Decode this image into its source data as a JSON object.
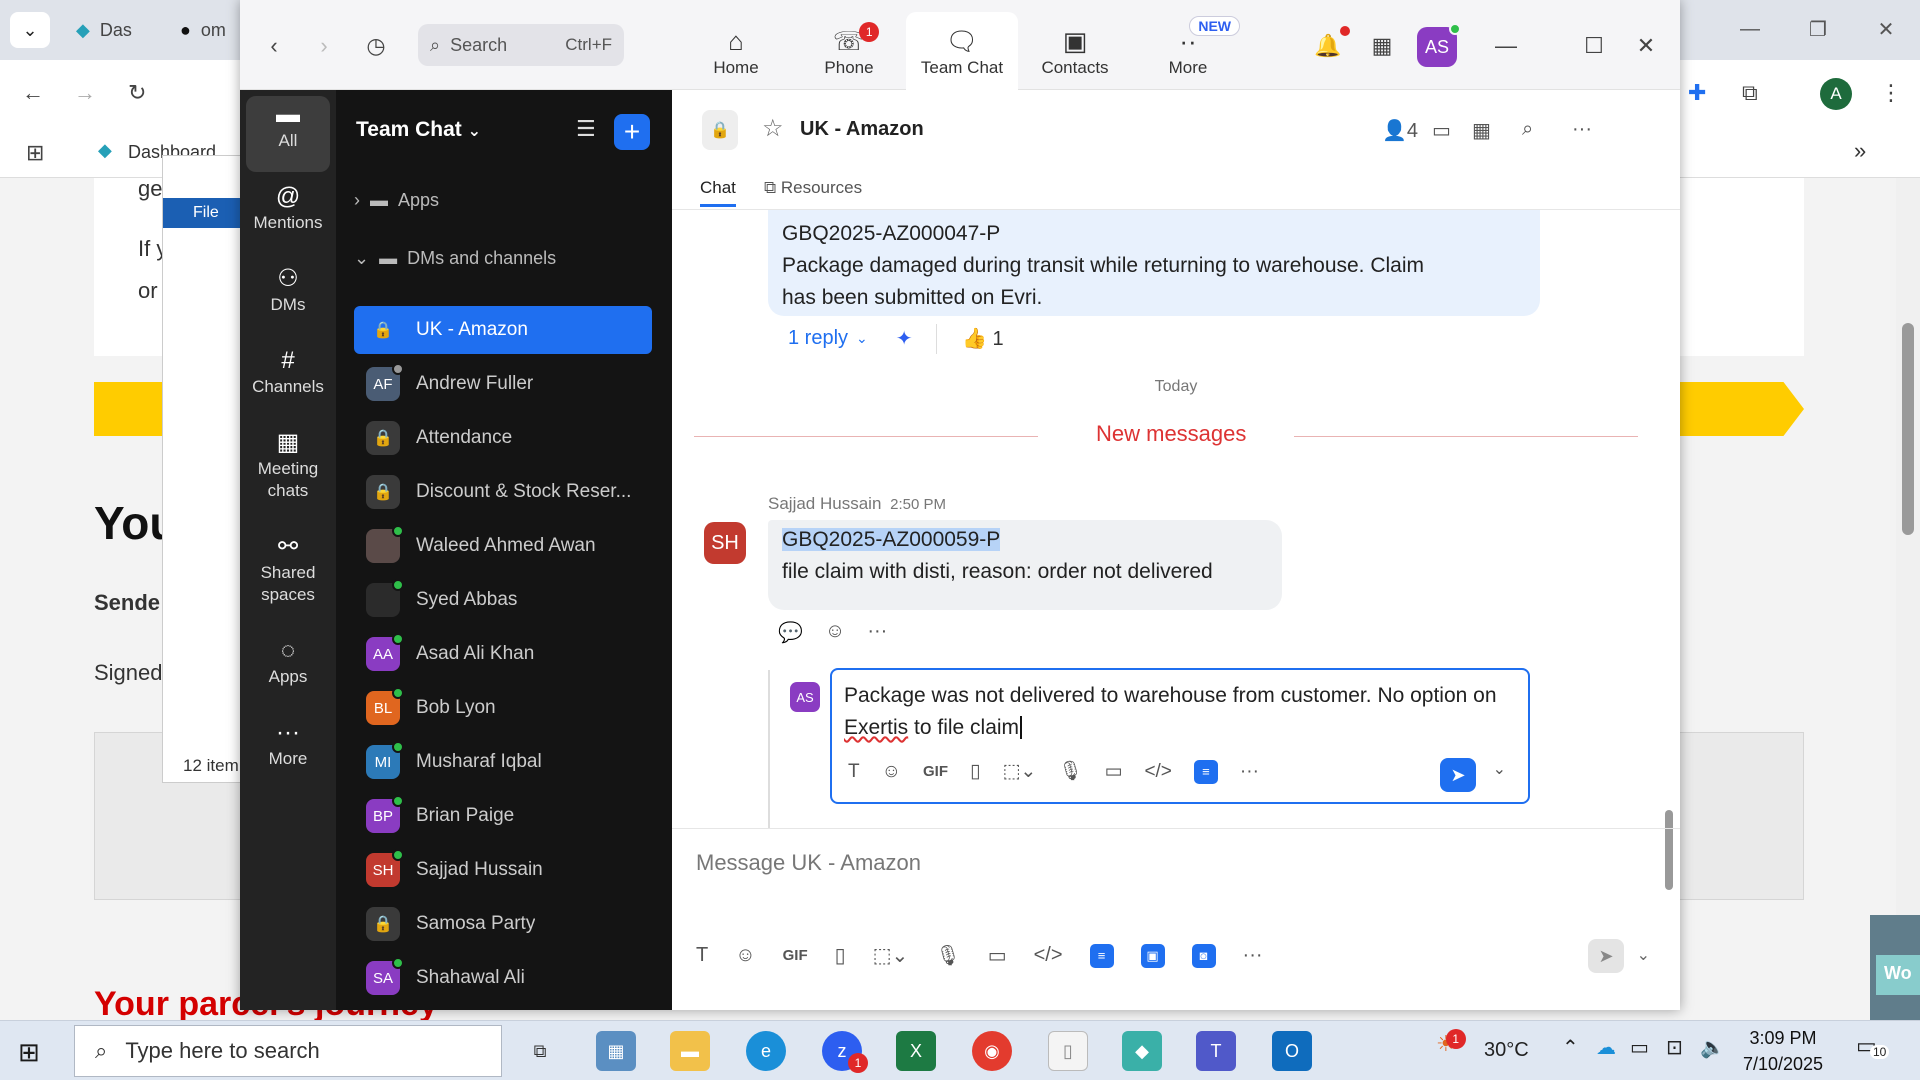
{
  "browser": {
    "tabs": [
      {
        "label": "Das"
      },
      {
        "label": "om"
      }
    ],
    "bookmark": "Dashboard",
    "page": {
      "snippet1": "ge",
      "snippet2": "If y",
      "snippet3": "or",
      "heading": "You",
      "sender_label": "Sende",
      "signed_label": "Signed",
      "journey_heading": "Your parcel's journey"
    },
    "explorer": {
      "file_tab": "File",
      "items_count": "12 item"
    },
    "corner_label": "Wo"
  },
  "zoom": {
    "search": {
      "placeholder": "Search",
      "shortcut": "Ctrl+F"
    },
    "tabs": [
      {
        "label": "Home",
        "icon": "home-icon"
      },
      {
        "label": "Phone",
        "icon": "phone-icon",
        "badge": "1"
      },
      {
        "label": "Team Chat",
        "icon": "chat-bubble-icon",
        "active": true
      },
      {
        "label": "Contacts",
        "icon": "contacts-icon"
      },
      {
        "label": "More",
        "icon": "more-icon",
        "badge": "NEW"
      }
    ],
    "user_initials": "AS",
    "rail": [
      {
        "label": "All",
        "icon": "chat-icon",
        "active": true
      },
      {
        "label": "Mentions",
        "icon": "at-icon"
      },
      {
        "label": "DMs",
        "icon": "people-icon"
      },
      {
        "label": "Channels",
        "icon": "hash-icon"
      },
      {
        "label": "Meeting chats",
        "icon": "calendar-icon"
      },
      {
        "label": "Shared spaces",
        "icon": "share-icon"
      },
      {
        "label": "Apps",
        "icon": "apps-icon"
      },
      {
        "label": "More",
        "icon": "ellipsis-icon"
      }
    ],
    "channel_list": {
      "title": "Team Chat",
      "sections": {
        "apps": "Apps",
        "dms": "DMs and channels"
      },
      "items": [
        {
          "name": "UK - Amazon",
          "type": "lock",
          "active": true
        },
        {
          "name": "Andrew Fuller",
          "type": "avatar",
          "initials": "AF",
          "color": "#4a5c74",
          "status": "away"
        },
        {
          "name": "Attendance",
          "type": "lock"
        },
        {
          "name": "Discount & Stock Reser...",
          "type": "lock"
        },
        {
          "name": "Waleed Ahmed Awan",
          "type": "photo",
          "color": "#5a4a48",
          "status": "online"
        },
        {
          "name": "Syed Abbas",
          "type": "photo",
          "color": "#2b2b2b",
          "status": "online"
        },
        {
          "name": "Asad Ali Khan",
          "type": "avatar",
          "initials": "AA",
          "color": "#8a3cc2",
          "status": "online"
        },
        {
          "name": "Bob Lyon",
          "type": "avatar",
          "initials": "BL",
          "color": "#e0661f",
          "status": "online"
        },
        {
          "name": "Musharaf Iqbal",
          "type": "avatar",
          "initials": "MI",
          "color": "#2c7ab8",
          "status": "online"
        },
        {
          "name": "Brian Paige",
          "type": "avatar",
          "initials": "BP",
          "color": "#8a3cc2",
          "status": "online"
        },
        {
          "name": "Sajjad Hussain",
          "type": "avatar",
          "initials": "SH",
          "color": "#c23a2f",
          "status": "online"
        },
        {
          "name": "Samosa Party",
          "type": "lock"
        },
        {
          "name": "Shahawal Ali",
          "type": "avatar",
          "initials": "SA",
          "color": "#8a3cc2",
          "status": "online"
        }
      ]
    },
    "chat": {
      "title": "UK - Amazon",
      "member_count": "4",
      "tabs": [
        "Chat",
        "Resources"
      ],
      "old_message": {
        "line1": "GBQ2025-AZ000047-P",
        "line2": "Package damaged during transit while returning to warehouse. Claim",
        "line3": "has been submitted on Evri."
      },
      "reply_label": "1 reply",
      "reaction": "👍 1",
      "day_divider": "Today",
      "new_messages_label": "New messages",
      "new_message": {
        "sender": "Sajjad Hussain",
        "sender_initials": "SH",
        "time": "2:50 PM",
        "highlighted": "GBQ2025-AZ000059-P",
        "text": "file claim with disti, reason: order not delivered"
      },
      "reply_draft": {
        "initials": "AS",
        "before": "Package was not delivered to warehouse from customer. No option on ",
        "misspelled": "Exertis",
        "after": " to file claim"
      },
      "composer_placeholder": "Message UK - Amazon"
    }
  },
  "taskbar": {
    "search_placeholder": "Type here to search",
    "weather_temp": "30°C",
    "weather_badge": "1",
    "time": "3:09 PM",
    "date": "7/10/2025",
    "notification_count": "10",
    "zoom_badge": "1"
  },
  "colors": {
    "accent": "#1f6ff0",
    "sidebar_dark": "#141414",
    "rail_dark": "#232323",
    "new_messages": "#d33333"
  }
}
